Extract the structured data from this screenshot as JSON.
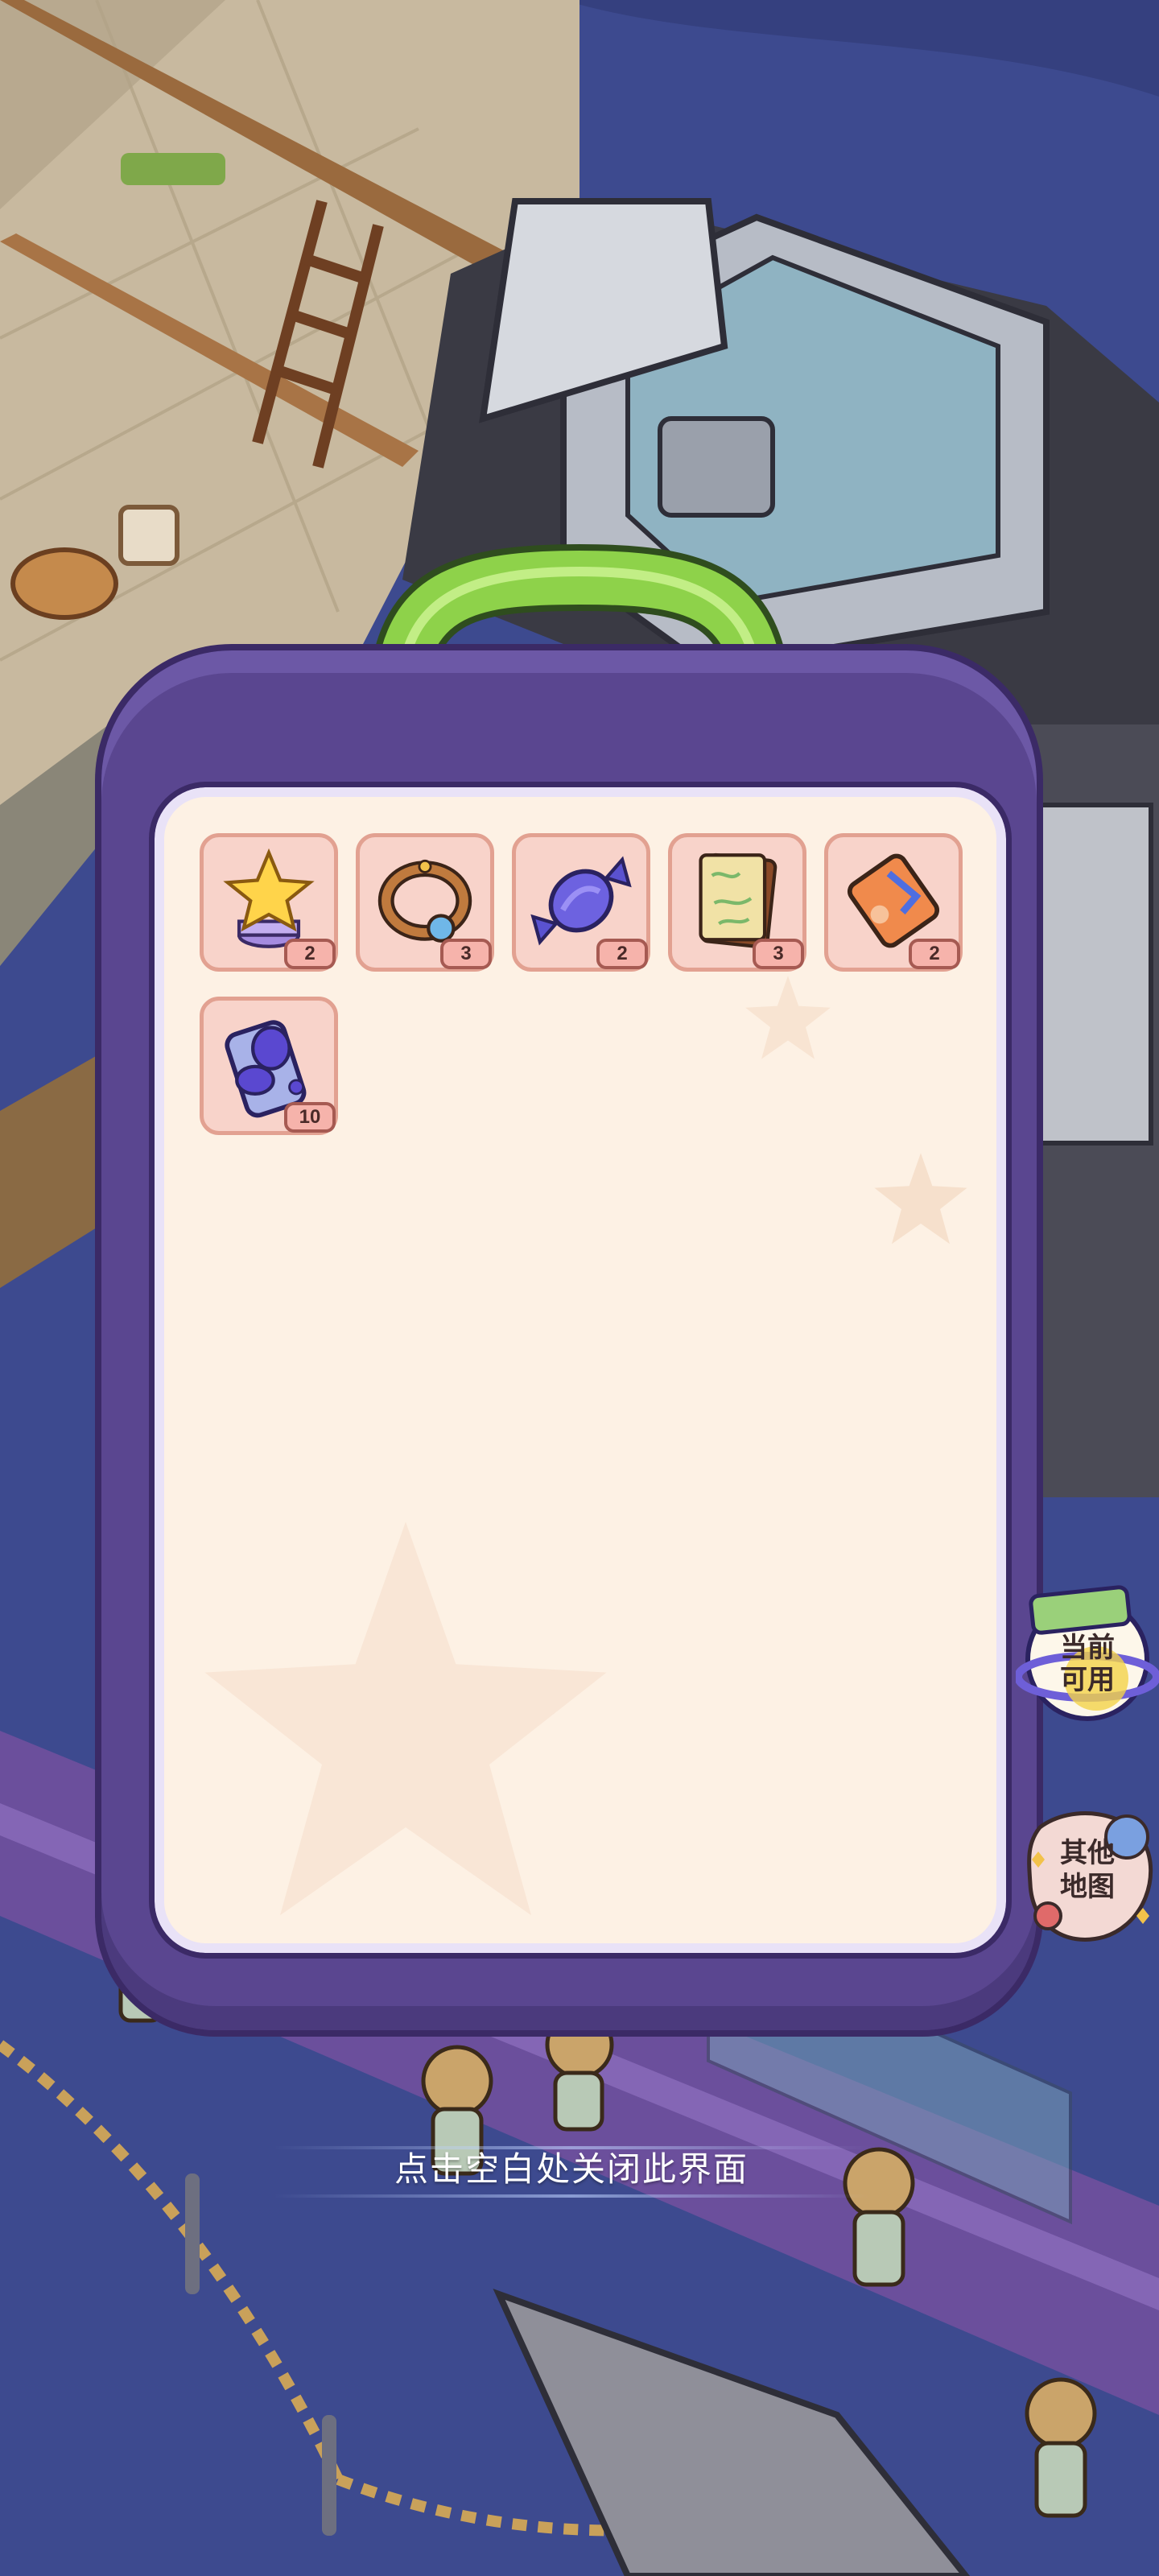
{
  "inventory": {
    "items": [
      {
        "name": "star-trophy",
        "count": "2"
      },
      {
        "name": "gem-bracelet",
        "count": "3"
      },
      {
        "name": "candy",
        "count": "2"
      },
      {
        "name": "map-book",
        "count": "3"
      },
      {
        "name": "ticket-card",
        "count": "2"
      },
      {
        "name": "purple-gel-slab",
        "count": "10"
      }
    ]
  },
  "side_buttons": {
    "current_available": [
      "当前",
      "可用"
    ],
    "other_maps": [
      "其他",
      "地图"
    ]
  },
  "hint": {
    "close_text": "点击空白处关闭此界面"
  },
  "colors": {
    "bag_purple": "#5a4690",
    "bag_outline": "#3b2a66",
    "inner_panel": "#fdf1e4",
    "slot_fill": "#f8d3ca",
    "handle_green": "#8ed24a",
    "background_blue": "#3f4a8c"
  }
}
